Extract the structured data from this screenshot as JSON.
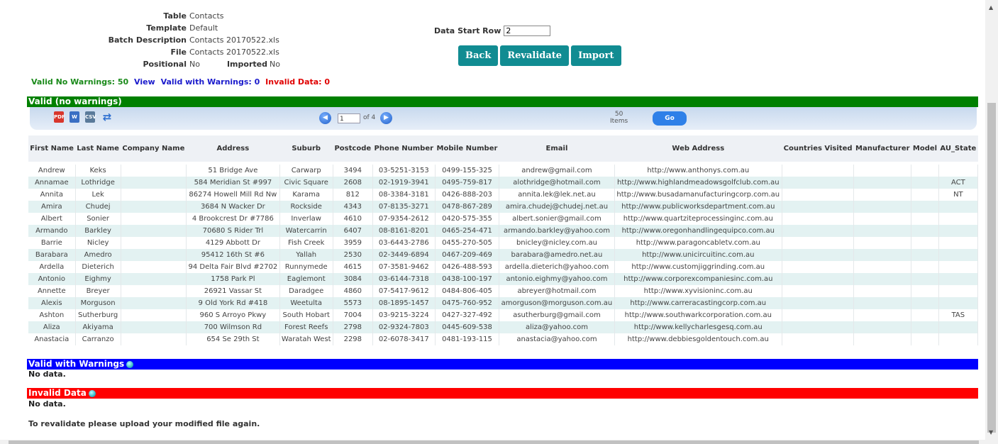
{
  "info": {
    "table_label": "Table",
    "table_value": "Contacts",
    "template_label": "Template",
    "template_value": "Default",
    "batch_label": "Batch Description",
    "batch_value": "Contacts 20170522.xls",
    "file_label": "File",
    "file_value": "Contacts 20170522.xls",
    "positional_label": "Positional",
    "positional_value": "No",
    "imported_label": "Imported",
    "imported_value": "No"
  },
  "summary": {
    "valid_no_warnings": "Valid No Warnings: 50",
    "view_link": "View",
    "valid_with_warnings": "Valid with Warnings: 0",
    "invalid_data": "Invalid Data: 0"
  },
  "data_start_row": {
    "label": "Data Start Row",
    "value": "2"
  },
  "buttons": {
    "back": "Back",
    "revalidate": "Revalidate",
    "import": "Import"
  },
  "sections": {
    "valid": "Valid (no warnings)",
    "warnings": "Valid with Warnings",
    "invalid": "Invalid Data",
    "no_data": "No data."
  },
  "toolbar": {
    "page": "1",
    "of": "of 4",
    "items_count": "50",
    "items_label": "Items",
    "go": "Go",
    "icons": [
      "pdf-icon",
      "word-icon",
      "csv-icon",
      "refresh-icon"
    ]
  },
  "table": {
    "columns": [
      "First Name",
      "Last Name",
      "Company Name",
      "Address",
      "Suburb",
      "Postcode",
      "Phone Number",
      "Mobile Number",
      "Email",
      "Web Address",
      "Countries Visited",
      "Manufacturer",
      "Model",
      "AU_State"
    ],
    "rows": [
      [
        "Andrew",
        "Keks",
        "",
        "51 Bridge Ave",
        "Carwarp",
        "3494",
        "03-5251-3153",
        "0499-155-325",
        "andrew@gmail.com",
        "http://www.anthonys.com.au",
        "",
        "",
        "",
        ""
      ],
      [
        "Annamae",
        "Lothridge",
        "",
        "584 Meridian St #997",
        "Civic Square",
        "2608",
        "02-1919-3941",
        "0495-759-817",
        "alothridge@hotmail.com",
        "http://www.highlandmeadowsgolfclub.com.au",
        "",
        "",
        "",
        "ACT"
      ],
      [
        "Annita",
        "Lek",
        "",
        "86274 Howell Mill Rd Nw",
        "Karama",
        "812",
        "08-3384-3181",
        "0426-888-203",
        "annita.lek@lek.net.au",
        "http://www.busadamanufacturingcorp.com.au",
        "",
        "",
        "",
        "NT"
      ],
      [
        "Amira",
        "Chudej",
        "",
        "3684 N Wacker Dr",
        "Rockside",
        "4343",
        "07-8135-3271",
        "0478-867-289",
        "amira.chudej@chudej.net.au",
        "http://www.publicworksdepartment.com.au",
        "",
        "",
        "",
        ""
      ],
      [
        "Albert",
        "Sonier",
        "",
        "4 Brookcrest Dr #7786",
        "Inverlaw",
        "4610",
        "07-9354-2612",
        "0420-575-355",
        "albert.sonier@gmail.com",
        "http://www.quartziteprocessinginc.com.au",
        "",
        "",
        "",
        ""
      ],
      [
        "Armando",
        "Barkley",
        "",
        "70680 S Rider Trl",
        "Watercarrin",
        "6407",
        "08-8161-8201",
        "0465-254-471",
        "armando.barkley@yahoo.com",
        "http://www.oregonhandlingequipco.com.au",
        "",
        "",
        "",
        ""
      ],
      [
        "Barrie",
        "Nicley",
        "",
        "4129 Abbott Dr",
        "Fish Creek",
        "3959",
        "03-6443-2786",
        "0455-270-505",
        "bnicley@nicley.com.au",
        "http://www.paragoncabletv.com.au",
        "",
        "",
        "",
        ""
      ],
      [
        "Barabara",
        "Amedro",
        "",
        "95412 16th St #6",
        "Yallah",
        "2530",
        "02-3449-6894",
        "0467-209-469",
        "barabara@amedro.net.au",
        "http://www.unicircuitinc.com.au",
        "",
        "",
        "",
        ""
      ],
      [
        "Ardella",
        "Dieterich",
        "",
        "94 Delta Fair Blvd #2702",
        "Runnymede",
        "4615",
        "07-3581-9462",
        "0426-488-593",
        "ardella.dieterich@yahoo.com",
        "http://www.customjiggrinding.com.au",
        "",
        "",
        "",
        ""
      ],
      [
        "Antonio",
        "Eighmy",
        "",
        "1758 Park Pl",
        "Eaglemont",
        "3084",
        "03-6144-7318",
        "0438-100-197",
        "antonio.eighmy@yahoo.com",
        "http://www.corporexcompaniesinc.com.au",
        "",
        "",
        "",
        ""
      ],
      [
        "Annette",
        "Breyer",
        "",
        "26921 Vassar St",
        "Daradgee",
        "4860",
        "07-5417-9612",
        "0484-806-405",
        "abreyer@hotmail.com",
        "http://www.xyvisioninc.com.au",
        "",
        "",
        "",
        ""
      ],
      [
        "Alexis",
        "Morguson",
        "",
        "9 Old York Rd #418",
        "Weetulta",
        "5573",
        "08-1895-1457",
        "0475-760-952",
        "amorguson@morguson.com.au",
        "http://www.carreracastingcorp.com.au",
        "",
        "",
        "",
        ""
      ],
      [
        "Ashton",
        "Sutherburg",
        "",
        "960 S Arroyo Pkwy",
        "South Hobart",
        "7004",
        "03-9215-3224",
        "0427-327-492",
        "asutherburg@gmail.com",
        "http://www.southwarkcorporation.com.au",
        "",
        "",
        "",
        "TAS"
      ],
      [
        "Aliza",
        "Akiyama",
        "",
        "700 Wilmson Rd",
        "Forest Reefs",
        "2798",
        "02-9324-7803",
        "0445-609-538",
        "aliza@yahoo.com",
        "http://www.kellycharlesgesq.com.au",
        "",
        "",
        "",
        ""
      ],
      [
        "Anastacia",
        "Carranzo",
        "",
        "654 Se 29th St",
        "Waratah West",
        "2298",
        "02-6078-3417",
        "0481-193-115",
        "anastacia@yahoo.com",
        "http://www.debbiesgoldentouch.com.au",
        "",
        "",
        "",
        ""
      ]
    ]
  },
  "footer_note": "To revalidate please upload your modified file again.",
  "colors": {
    "accent": "#118c92",
    "valid": "#008000",
    "warnings": "#0000ff",
    "invalid": "#ff0000"
  }
}
